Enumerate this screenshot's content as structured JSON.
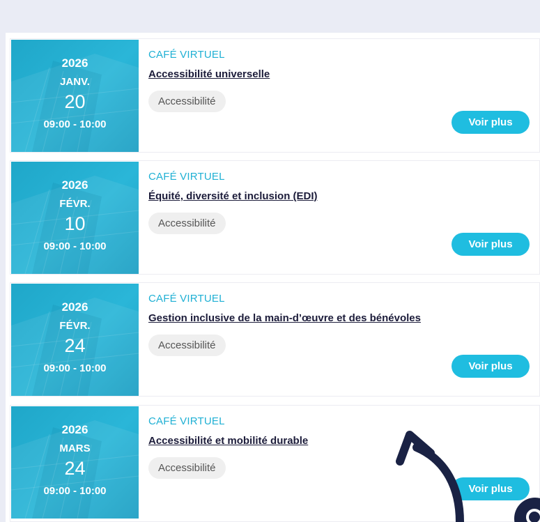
{
  "events": [
    {
      "year": "2026",
      "month": "JANV.",
      "day": "20",
      "time": "09:00 - 10:00",
      "kind": "CAFÉ VIRTUEL",
      "title": "Accessibilité universelle",
      "tag": "Accessibilité",
      "cta": "Voir plus"
    },
    {
      "year": "2026",
      "month": "FÉVR.",
      "day": "10",
      "time": "09:00 - 10:00",
      "kind": "CAFÉ VIRTUEL",
      "title": "Équité, diversité et inclusion (EDI)",
      "tag": "Accessibilité",
      "cta": "Voir plus"
    },
    {
      "year": "2026",
      "month": "FÉVR.",
      "day": "24",
      "time": "09:00 - 10:00",
      "kind": "CAFÉ VIRTUEL",
      "title": "Gestion inclusive de la main-d’œuvre et des bénévoles",
      "tag": "Accessibilité",
      "cta": "Voir plus"
    },
    {
      "year": "2026",
      "month": "MARS",
      "day": "24",
      "time": "09:00 - 10:00",
      "kind": "CAFÉ VIRTUEL",
      "title": "Accessibilité et mobilité durable",
      "tag": "Accessibilité",
      "cta": "Voir plus"
    }
  ],
  "colors": {
    "page_background": "#eaecf5",
    "date_tile": "#2ab6d8",
    "accent": "#1fbde0",
    "title_text": "#1c1c3a",
    "arrow": "#1a2244"
  },
  "icons": {
    "arrow": "curved-arrow-icon",
    "badge": "help-badge-icon"
  }
}
